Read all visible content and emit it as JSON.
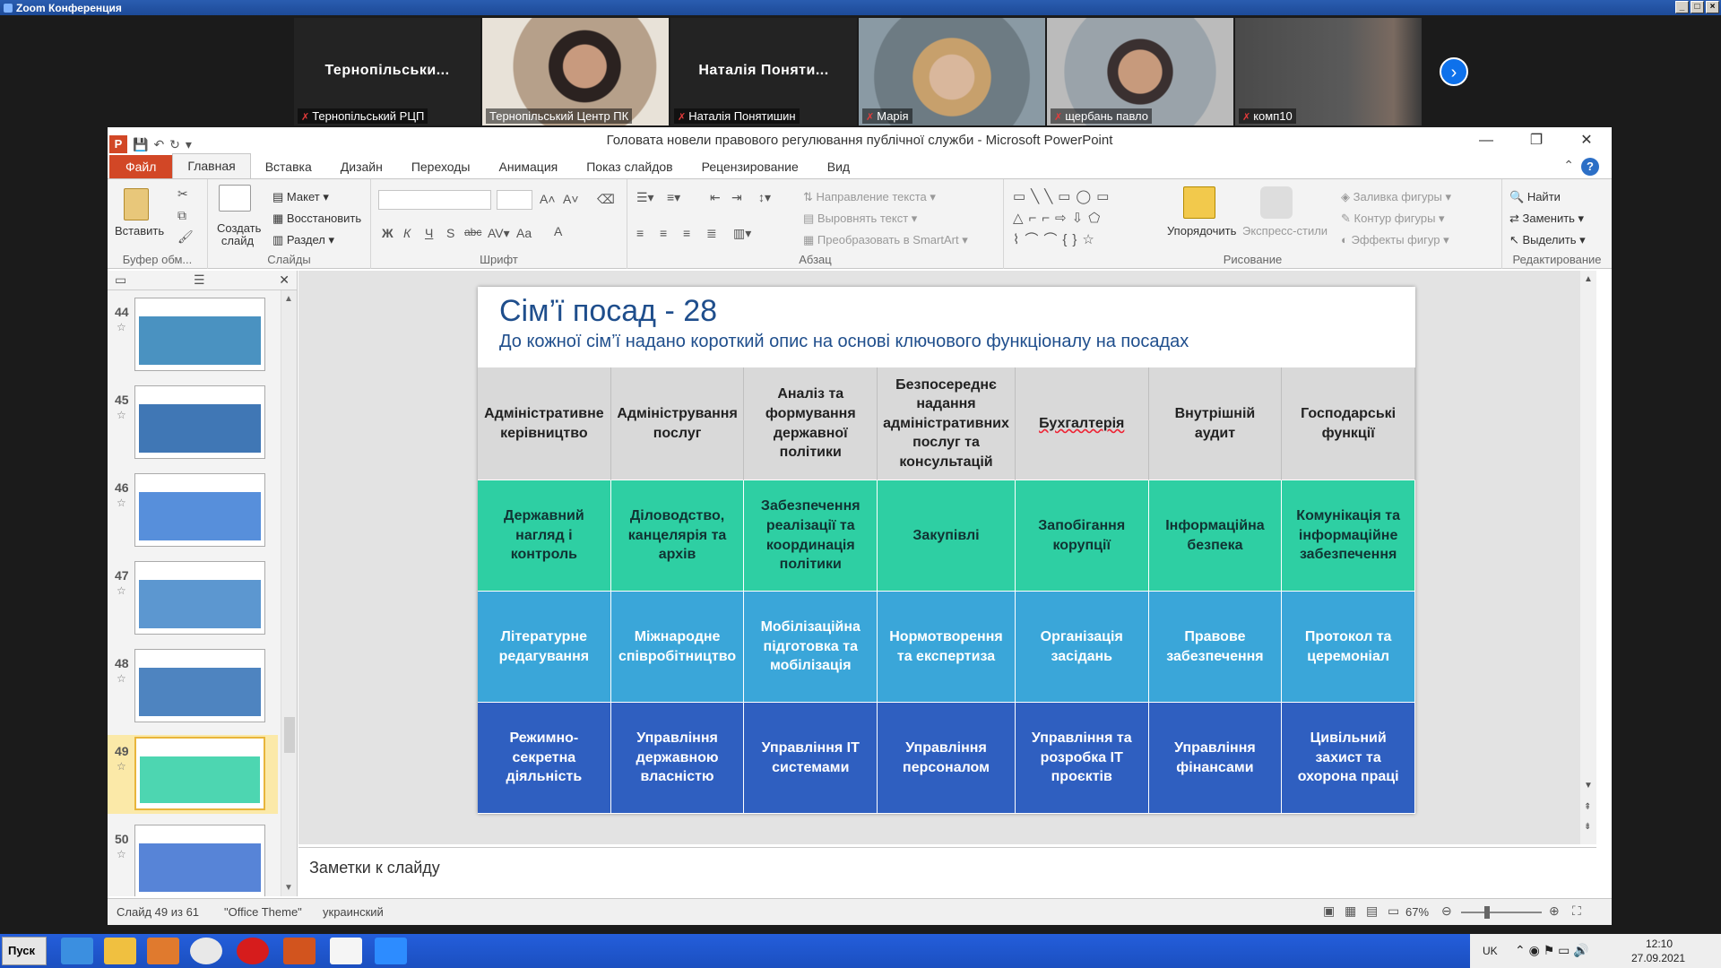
{
  "zoom": {
    "title": "Zoom Конференция",
    "participants": [
      {
        "big_name": "Тернопільськи...",
        "label": "Тернопільський РЦП",
        "muted": true,
        "video": false
      },
      {
        "big_name": "",
        "label": "Тернопільський Центр ПК",
        "muted": false,
        "video": true,
        "active": true
      },
      {
        "big_name": "Наталія Поняти...",
        "label": "Наталія Понятишин",
        "muted": true,
        "video": false
      },
      {
        "big_name": "",
        "label": "Марія",
        "muted": true,
        "video": true
      },
      {
        "big_name": "",
        "label": "щербань павло",
        "muted": true,
        "video": true
      },
      {
        "big_name": "",
        "label": "комп10",
        "muted": true,
        "video": true
      }
    ],
    "next_icon": "chevron-right-icon"
  },
  "ppt": {
    "window_title": "Головата новели правового регулювання публічної служби  -  Microsoft PowerPoint",
    "tabs": [
      "Файл",
      "Главная",
      "Вставка",
      "Дизайн",
      "Переходы",
      "Анимация",
      "Показ слайдов",
      "Рецензирование",
      "Вид"
    ],
    "active_tab": "Главная",
    "ribbon": {
      "clipboard": {
        "label": "Буфер обм...",
        "paste": "Вставить"
      },
      "slides": {
        "label": "Слайды",
        "new_slide": "Создать слайд",
        "layout": "Макет",
        "reset": "Восстановить",
        "section": "Раздел"
      },
      "font": {
        "label": "Шрифт",
        "bold": "Ж",
        "italic": "К",
        "underline": "Ч",
        "strike": "S",
        "abc": "abc",
        "aa": "Aa",
        "a": "A"
      },
      "paragraph": {
        "label": "Абзац",
        "text_direction": "Направление текста",
        "align_text": "Выровнять текст",
        "smartart": "Преобразовать в SmartArt"
      },
      "drawing": {
        "label": "Рисование",
        "arrange": "Упорядочить",
        "quick_styles": "Экспресс-стили",
        "fill": "Заливка фигуры",
        "outline": "Контур фигуры",
        "effects": "Эффекты фигур"
      },
      "editing": {
        "label": "Редактирование",
        "find": "Найти",
        "replace": "Заменить",
        "select": "Выделить"
      }
    },
    "thumbnails": [
      {
        "num": "44",
        "selected": false,
        "accent": "#2a7fb6"
      },
      {
        "num": "45",
        "selected": false,
        "accent": "#1f5fa8"
      },
      {
        "num": "46",
        "selected": false,
        "accent": "#3a7bd5"
      },
      {
        "num": "47",
        "selected": false,
        "accent": "#3f85c8"
      },
      {
        "num": "48",
        "selected": false,
        "accent": "#2f6fb5"
      },
      {
        "num": "49",
        "selected": true,
        "accent": "#2ecfa3"
      },
      {
        "num": "50",
        "selected": false,
        "accent": "#3a6fd0"
      }
    ],
    "slide": {
      "title": "Сім’ї посад - 28",
      "subtitle": "До кожної сім’ї надано короткий опис на основі ключового функціоналу на посадах",
      "rows": [
        [
          "Адміністративне керівництво",
          "Адміністрування послуг",
          "Аналіз та формування державної політики",
          "Безпосереднє надання адміністративних послуг та консультацій",
          "Бухгалтерія",
          "Внутрішній аудит",
          "Господарські функції"
        ],
        [
          "Державний нагляд і контроль",
          "Діловодство, канцелярія та архів",
          "Забезпечення реалізації та координація політики",
          "Закупівлі",
          "Запобігання корупції",
          "Інформаційна безпека",
          "Комунікація та інформаційне забезпечення"
        ],
        [
          "Літературне редагування",
          "Міжнародне співробітництво",
          "Мобілізаційна підготовка та мобілізація",
          "Нормотворення та експертиза",
          "Організація засідань",
          "Правове забезпечення",
          "Протокол та церемоніал"
        ],
        [
          "Режимно-секретна діяльність",
          "Управління державною власністю",
          "Управління ІТ системами",
          "Управління персоналом",
          "Управління та розробка ІТ проєктів",
          "Управління фінансами",
          "Цивільний захист та охорона праці"
        ]
      ]
    },
    "notes_placeholder": "Заметки к слайду",
    "status": {
      "slide_of": "Слайд 49 из 61",
      "theme": "\"Office Theme\"",
      "language": "украинский",
      "zoom": "67%"
    }
  },
  "taskbar": {
    "start": "Пуск",
    "lang": "UK",
    "time": "12:10",
    "date": "27.09.2021"
  }
}
